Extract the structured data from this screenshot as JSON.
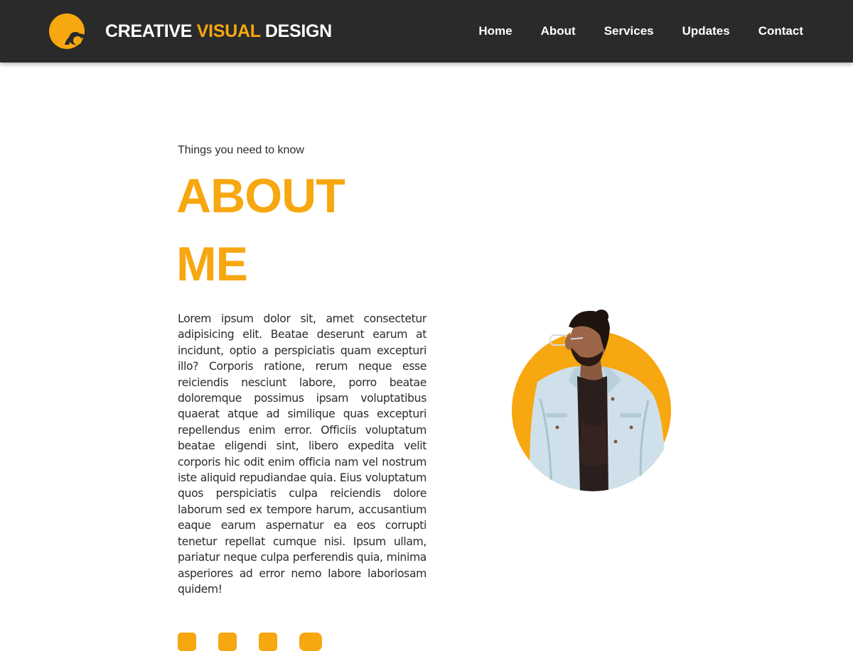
{
  "colors": {
    "accent": "#f7a70f",
    "header_bg": "#2a2a2a",
    "text": "#2b2b2b"
  },
  "header": {
    "logo_icon": "c-shaped-logo-icon",
    "brand_part1": "CREATIVE ",
    "brand_accent": "VISUAL",
    "brand_part2": " DESIGN",
    "nav": [
      "Home",
      "About",
      "Services",
      "Updates",
      "Contact"
    ]
  },
  "about": {
    "eyebrow": "Things you need to know",
    "title_line1": "ABOUT",
    "title_line2": "ME",
    "body": "Lorem ipsum dolor sit, amet consectetur adipisicing elit. Beatae deserunt earum at incidunt, optio a perspiciatis quam excepturi illo? Corporis ratione, rerum neque esse reiciendis nesciunt labore, porro beatae doloremque possimus ipsam voluptatibus quaerat atque ad similique quas excepturi repellendus enim error. Officiis voluptatum beatae eligendi sint, libero expedita velit corporis hic odit enim officia nam vel nostrum iste aliquid repudiandae quia. Eius voluptatum quos perspiciatis culpa reiciendis dolore laborum sed ex tempore harum, accusantium eaque earum aspernatur ea eos corrupti tenetur repellat cumque nisi. Ipsum ullam, pariatur neque culpa perferendis quia, minima asperiores ad error nemo labore laboriosam quidem!"
  },
  "social": [
    "facebook-icon",
    "x-twitter-icon",
    "instagram-icon",
    "youtube-icon"
  ],
  "portrait": {
    "icon": "person-portrait-on-orange-circle"
  }
}
